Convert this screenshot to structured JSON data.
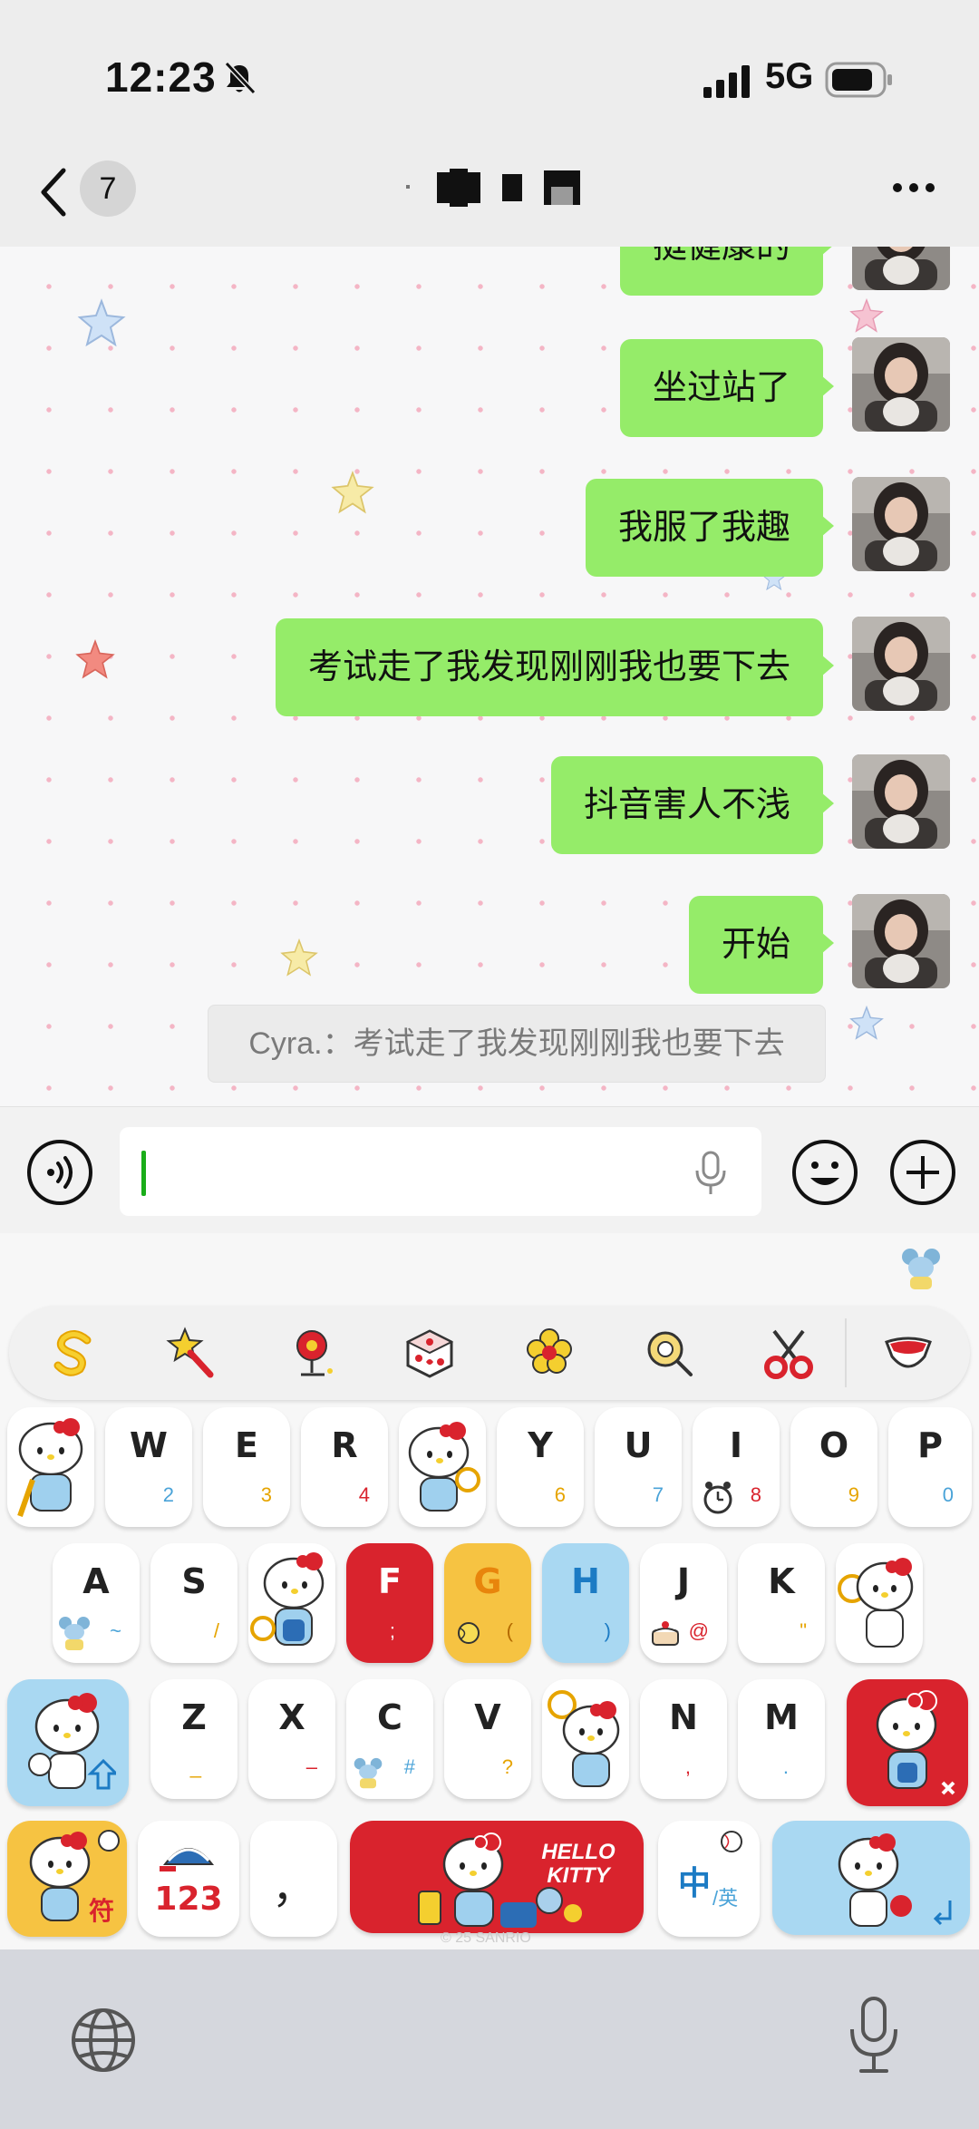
{
  "status": {
    "time": "12:23",
    "network": "5G"
  },
  "nav": {
    "unread": "7"
  },
  "messages": [
    {
      "text": "挺健康的"
    },
    {
      "text": "坐过站了"
    },
    {
      "text": "我服了我趣"
    },
    {
      "text": "考试走了我发现刚刚我也要下去"
    },
    {
      "text": "抖音害人不浅"
    },
    {
      "text": "开始"
    }
  ],
  "quote": "Cyra.：考试走了我发现刚刚我也要下去",
  "keyboard": {
    "row1": [
      {
        "letter": "",
        "sub": ""
      },
      {
        "letter": "W",
        "sub": "2"
      },
      {
        "letter": "E",
        "sub": "3"
      },
      {
        "letter": "R",
        "sub": "4"
      },
      {
        "letter": "",
        "sub": ""
      },
      {
        "letter": "Y",
        "sub": "6"
      },
      {
        "letter": "U",
        "sub": "7"
      },
      {
        "letter": "I",
        "sub": "8"
      },
      {
        "letter": "O",
        "sub": "9"
      },
      {
        "letter": "P",
        "sub": "0"
      }
    ],
    "row2": [
      {
        "letter": "A",
        "sub": "~"
      },
      {
        "letter": "S",
        "sub": "/"
      },
      {
        "letter": "",
        "sub": ""
      },
      {
        "letter": "F",
        "sub": ";"
      },
      {
        "letter": "G",
        "sub": "("
      },
      {
        "letter": "H",
        "sub": ")"
      },
      {
        "letter": "J",
        "sub": "@"
      },
      {
        "letter": "K",
        "sub": "\""
      },
      {
        "letter": "",
        "sub": ""
      }
    ],
    "row3": [
      {
        "letter": "Z",
        "sub": "_"
      },
      {
        "letter": "X",
        "sub": "–"
      },
      {
        "letter": "C",
        "sub": "#"
      },
      {
        "letter": "V",
        "sub": "?"
      },
      {
        "letter": "",
        "sub": ""
      },
      {
        "letter": "N",
        "sub": ","
      },
      {
        "letter": "M",
        "sub": "."
      }
    ],
    "symbols_label": "符",
    "numbers_label": "123",
    "comma_label": "，",
    "space_title": "HELLO KITTY",
    "lang_main": "中",
    "lang_sub": "/英",
    "copyright": "© 25 SANRIO"
  },
  "colors": {
    "bubble": "#95ec69",
    "accent_red": "#d9232d",
    "accent_yellow": "#f6c342",
    "accent_blue": "#a9d8f2",
    "caret": "#1aad19"
  }
}
